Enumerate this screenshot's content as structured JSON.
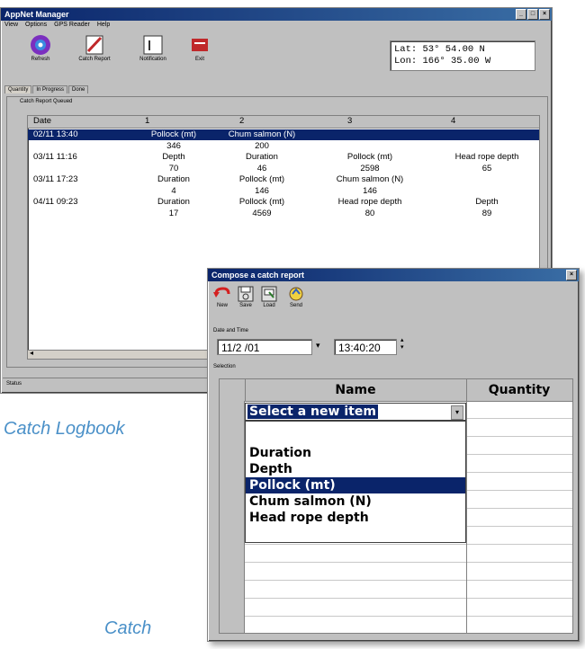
{
  "main_window": {
    "title": "AppNet Manager",
    "menu": [
      "View",
      "Options",
      "GPS Reader",
      "Help"
    ],
    "toolbar": [
      {
        "label": "Refresh",
        "icon": "refresh-icon"
      },
      {
        "label": "Catch Report",
        "icon": "catch-report-icon"
      },
      {
        "label": "Notification",
        "icon": "notification-icon"
      },
      {
        "label": "Exit",
        "icon": "exit-icon"
      }
    ],
    "gps": {
      "lat": "Lat:  53° 54.00 N",
      "lon": "Lon: 166° 35.00 W"
    },
    "tabs": [
      "Quantity",
      "In Progress",
      "Done"
    ],
    "group_label": "Catch Report Queued",
    "grid": {
      "headers": [
        "Date",
        "1",
        "2",
        "3",
        "4"
      ],
      "rows": [
        {
          "date": "02/11 13:40",
          "c1": "Pollock (mt)",
          "c2": "Chum salmon (N)",
          "c3": "",
          "c4": ""
        },
        {
          "date": "",
          "c1": "346",
          "c2": "200",
          "c3": "",
          "c4": ""
        },
        {
          "date": "03/11 11:16",
          "c1": "Depth",
          "c2": "Duration",
          "c3": "Pollock (mt)",
          "c4": "Head rope depth"
        },
        {
          "date": "",
          "c1": "70",
          "c2": "46",
          "c3": "2598",
          "c4": "65"
        },
        {
          "date": "03/11 17:23",
          "c1": "Duration",
          "c2": "Pollock (mt)",
          "c3": "Chum salmon (N)",
          "c4": ""
        },
        {
          "date": "",
          "c1": "4",
          "c2": "146",
          "c3": "146",
          "c4": ""
        },
        {
          "date": "04/11 09:23",
          "c1": "Duration",
          "c2": "Pollock (mt)",
          "c3": "Head rope depth",
          "c4": "Depth"
        },
        {
          "date": "",
          "c1": "17",
          "c2": "4569",
          "c3": "80",
          "c4": "89"
        }
      ]
    },
    "status_label": "Status"
  },
  "dialog": {
    "title": "Compose a catch report",
    "toolbar": [
      {
        "label": "New",
        "icon": "new-icon"
      },
      {
        "label": "Save",
        "icon": "save-icon"
      },
      {
        "label": "Load",
        "icon": "load-icon"
      },
      {
        "label": "Send",
        "icon": "send-icon"
      }
    ],
    "datetime_label": "Date and Time",
    "date_value": "11/2 /01",
    "time_value": "13:40:20",
    "selection_label": "Selection",
    "columns": [
      "Name",
      "Quantity"
    ],
    "select_placeholder": "Select a new item",
    "options": [
      "Duration",
      "Depth",
      "Pollock (mt)",
      "Chum salmon (N)",
      "Head rope depth"
    ],
    "selected_option": "Pollock (mt)"
  },
  "captions": {
    "logbook": "Catch Logbook",
    "catch": "Catch"
  }
}
